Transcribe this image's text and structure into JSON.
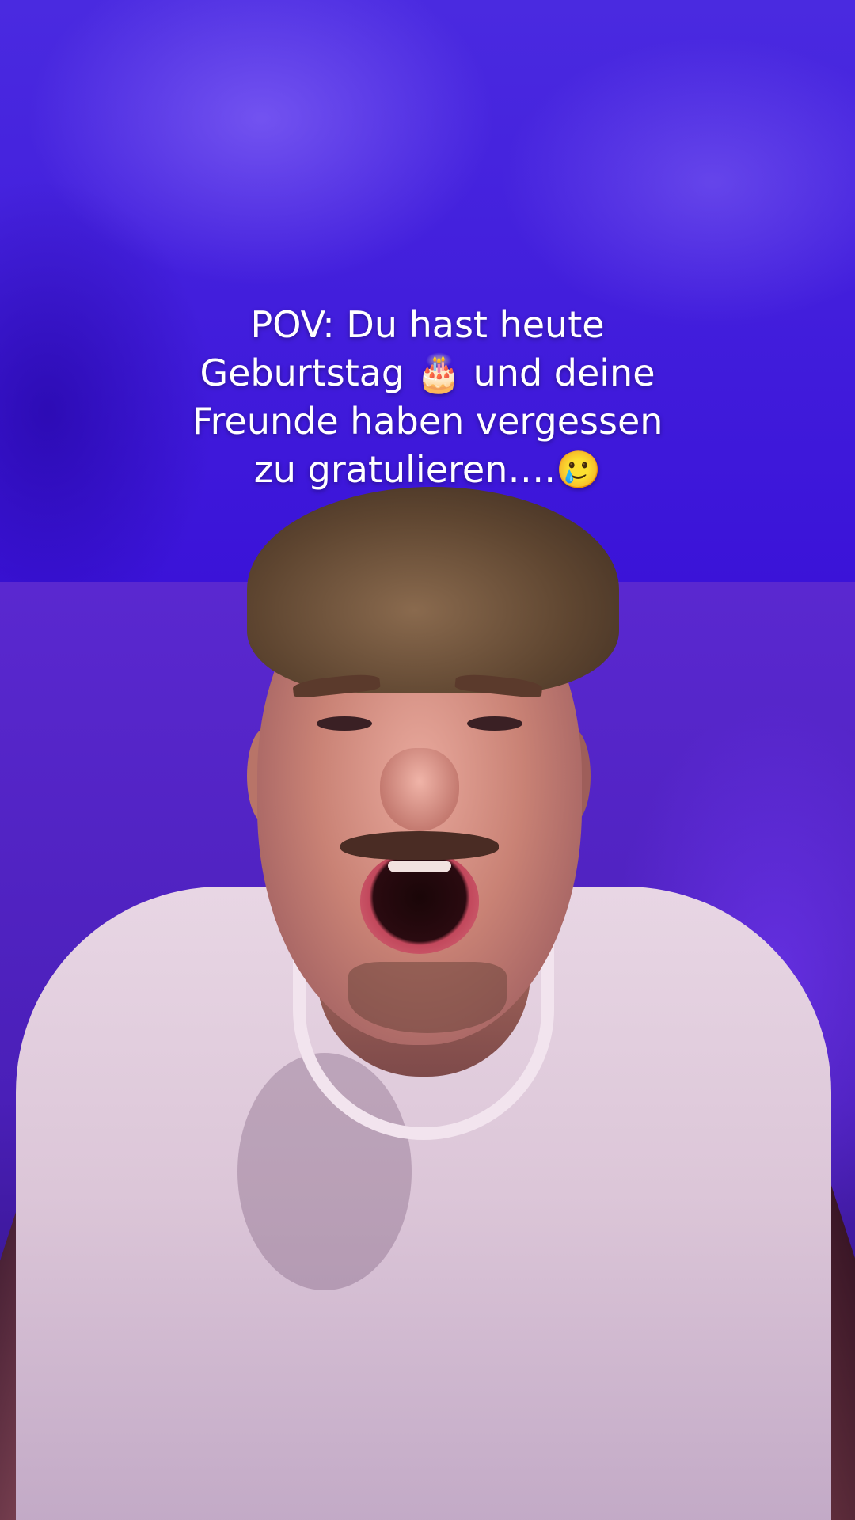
{
  "caption": {
    "line1": "POV: Du hast heute",
    "line2": "Geburtstag 🎂 und deine",
    "line3": "Freunde haben vergessen",
    "line4": "zu gratulieren….🥲"
  }
}
